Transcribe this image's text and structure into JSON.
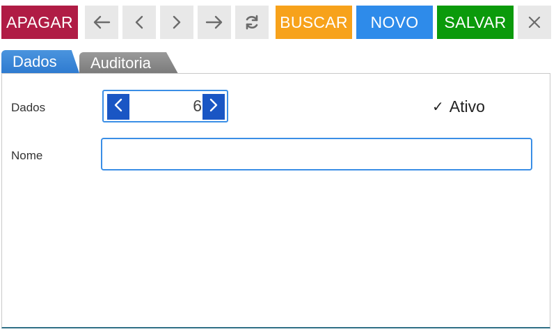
{
  "toolbar": {
    "delete_label": "APAGAR",
    "search_label": "BUSCAR",
    "new_label": "NOVO",
    "save_label": "SALVAR",
    "colors": {
      "delete": "#b01c45",
      "nav_bg": "#e8e8e8",
      "search": "#f7a21b",
      "new": "#2e8bea",
      "save": "#0b9a0b",
      "close_bg": "#e8e8e8"
    },
    "icons": [
      "arrow-left-icon",
      "chevron-left-icon",
      "chevron-right-icon",
      "arrow-right-icon",
      "refresh-icon",
      "close-icon"
    ]
  },
  "tabs": [
    {
      "label": "Dados",
      "active": true
    },
    {
      "label": "Auditoria",
      "active": false
    }
  ],
  "form": {
    "id_label": "Dados",
    "id_value": "6",
    "active_label": "Ativo",
    "active_checked": true,
    "name_label": "Nome",
    "name_value": ""
  }
}
